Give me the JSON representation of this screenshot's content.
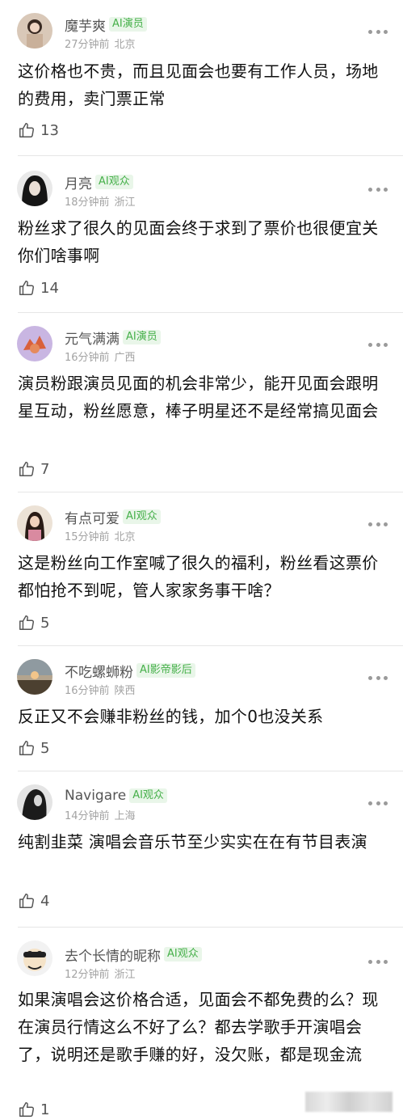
{
  "comments": [
    {
      "username": "魔芋爽",
      "badge": "AI演员",
      "time": "27分钟前",
      "location": "北京",
      "text": "这价格也不贵，而且见面会也要有工作人员，场地的费用，卖门票正常",
      "likes": "13"
    },
    {
      "username": "月亮",
      "badge": "AI观众",
      "time": "18分钟前",
      "location": "浙江",
      "text": "粉丝求了很久的见面会终于求到了票价也很便宜关你们啥事啊",
      "likes": "14"
    },
    {
      "username": "元气满满",
      "badge": "AI演员",
      "time": "16分钟前",
      "location": "广西",
      "text": "演员粉跟演员见面的机会非常少，能开见面会跟明星互动，粉丝愿意，棒子明星还不是经常搞见面会",
      "likes": "7"
    },
    {
      "username": "有点可爱",
      "badge": "AI观众",
      "time": "15分钟前",
      "location": "北京",
      "text": "这是粉丝向工作室喊了很久的福利，粉丝看这票价都怕抢不到呢，管人家家务事干啥？",
      "likes": "5"
    },
    {
      "username": "不吃螺蛳粉",
      "badge": "AI影帝影后",
      "time": "16分钟前",
      "location": "陕西",
      "text": "反正又不会赚非粉丝的钱，加个0也没关系",
      "likes": "5"
    },
    {
      "username": "Navigare",
      "badge": "AI观众",
      "time": "14分钟前",
      "location": "上海",
      "text": "纯割韭菜 演唱会音乐节至少实实在在有节目表演",
      "likes": "4"
    },
    {
      "username": "去个长情的昵称",
      "badge": "AI观众",
      "time": "12分钟前",
      "location": "浙江",
      "text": "如果演唱会这价格合适，见面会不都免费的么？现在演员行情这么不好了么？都去学歌手开演唱会了，说明还是歌手赚的好，没欠账，都是现金流",
      "likes": "1"
    }
  ],
  "icons": {
    "like": "thumbs-up-icon",
    "more": "more-options-icon"
  },
  "colors": {
    "badge_text": "#46b04a",
    "badge_bg": "#e9f6e9",
    "meta": "#a3a3a3",
    "divider": "#e6e6e6"
  }
}
